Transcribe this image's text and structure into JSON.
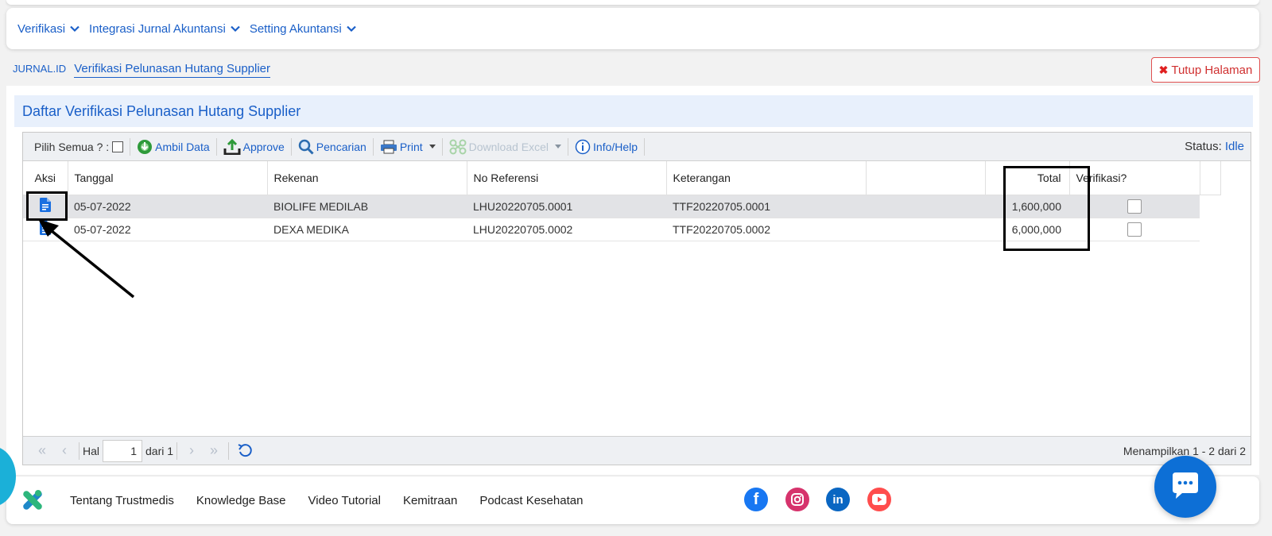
{
  "menu": {
    "items": [
      {
        "label": "Verifikasi"
      },
      {
        "label": "Integrasi Jurnal Akuntansi"
      },
      {
        "label": "Setting Akuntansi"
      }
    ]
  },
  "breadcrumb": {
    "root": "JURNAL.ID",
    "current": "Verifikasi Pelunasan Hutang Supplier"
  },
  "close_button": {
    "label": "Tutup Halaman"
  },
  "panel": {
    "title": "Daftar Verifikasi Pelunasan Hutang Supplier"
  },
  "toolbar": {
    "select_all": "Pilih Semua ? :",
    "ambil_data": "Ambil Data",
    "approve": "Approve",
    "pencarian": "Pencarian",
    "print": "Print",
    "download_excel": "Download Excel",
    "info_help": "Info/Help",
    "status_label": "Status:",
    "status_value": "Idle"
  },
  "table": {
    "headers": {
      "aksi": "Aksi",
      "tanggal": "Tanggal",
      "rekenan": "Rekenan",
      "no_referensi": "No Referensi",
      "keterangan": "Keterangan",
      "blank": "",
      "total": "Total",
      "verifikasi": "Verifikasi?"
    },
    "rows": [
      {
        "tanggal": "05-07-2022",
        "rekenan": "BIOLIFE MEDILAB",
        "no_referensi": "LHU20220705.0001",
        "keterangan": "TTF20220705.0001",
        "total": "1,600,000"
      },
      {
        "tanggal": "05-07-2022",
        "rekenan": "DEXA MEDIKA",
        "no_referensi": "LHU20220705.0002",
        "keterangan": "TTF20220705.0002",
        "total": "6,000,000"
      }
    ]
  },
  "pager": {
    "hal": "Hal",
    "page": "1",
    "dari": "dari 1",
    "info": "Menampilkan 1 - 2 dari 2"
  },
  "footer": {
    "links": [
      "Tentang Trustmedis",
      "Knowledge Base",
      "Video Tutorial",
      "Kemitraan",
      "Podcast Kesehatan"
    ],
    "social": {
      "facebook": "f",
      "linkedin": "in"
    }
  },
  "colors": {
    "accent": "#1a5fc8",
    "danger": "#d03030",
    "chat": "#0d6fd6",
    "facebook": "#1877f2",
    "instagram": "#d6336c",
    "linkedin": "#0a66c2",
    "youtube": "#ff4d4d"
  }
}
